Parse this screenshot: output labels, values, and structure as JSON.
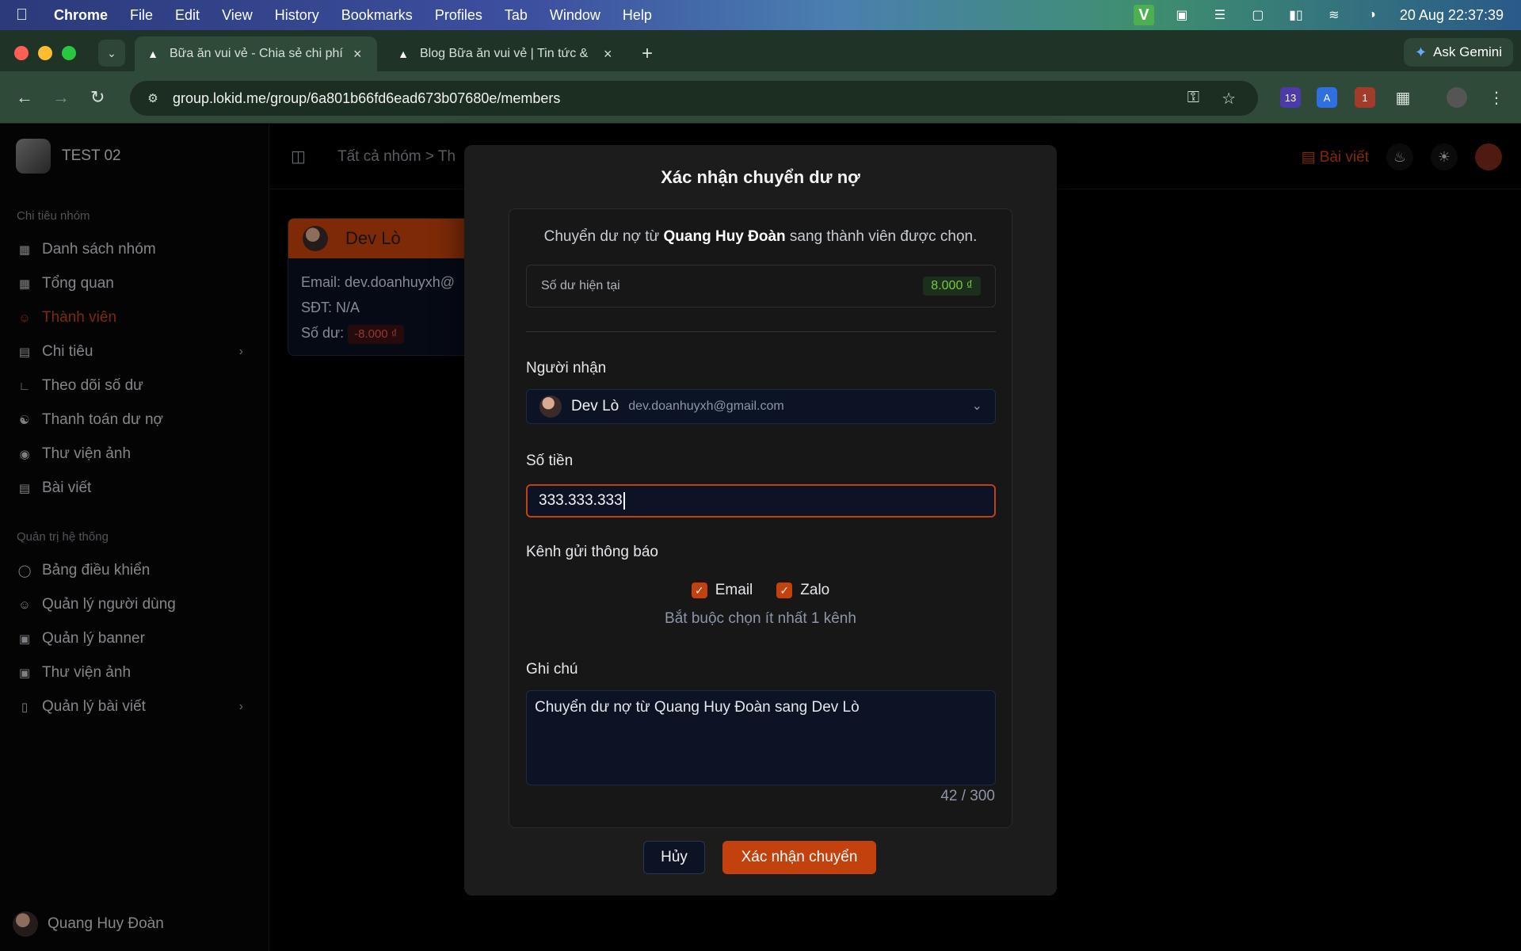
{
  "menubar": {
    "items": [
      "Chrome",
      "File",
      "Edit",
      "View",
      "History",
      "Bookmarks",
      "Profiles",
      "Tab",
      "Window",
      "Help"
    ],
    "datetime": "20 Aug  22:37:39"
  },
  "browser": {
    "tabs": [
      {
        "title": "Bữa ăn vui vẻ - Chia sẻ chi phí",
        "active": true
      },
      {
        "title": "Blog Bữa ăn vui vẻ | Tin tức &",
        "active": false
      }
    ],
    "url": "group.lokid.me/group/6a801b66fd6ead673b07680e/members",
    "gemini_label": "Ask Gemini",
    "ext_badges": [
      "13",
      "1"
    ]
  },
  "sidebar": {
    "brand": "TEST 02",
    "section1": "Chi tiêu nhóm",
    "items1": [
      "Danh sách nhóm",
      "Tổng quan",
      "Thành viên",
      "Chi tiêu",
      "Theo dõi số dư",
      "Thanh toán dư nợ",
      "Thư viện ảnh",
      "Bài viết"
    ],
    "section2": "Quản trị hệ thống",
    "items2": [
      "Bảng điều khiển",
      "Quản lý người dùng",
      "Quản lý banner",
      "Thư viện ảnh",
      "Quản lý bài viết"
    ],
    "user": "Quang Huy Đoàn"
  },
  "header": {
    "crumb": "Tất cả nhóm  >  Th",
    "posts": "Bài viết"
  },
  "member_card": {
    "name": "Dev Lò",
    "email": "Email: dev.doanhuyxh@",
    "phone": "SĐT: N/A",
    "balance_label": "Số dư:",
    "balance": "-8.000 ₫"
  },
  "modal": {
    "title": "Xác nhận chuyển dư nợ",
    "desc_pre": "Chuyển dư nợ từ ",
    "desc_from": "Quang Huy Đoàn",
    "desc_post": " sang thành viên được chọn.",
    "balance_label": "Số dư hiện tại",
    "balance_value": "8.000 ₫",
    "recipient_label": "Người nhận",
    "recipient_name": "Dev Lò",
    "recipient_email": "dev.doanhuyxh@gmail.com",
    "amount_label": "Số tiền",
    "amount_value": "333.333.333",
    "channel_label": "Kênh gửi thông báo",
    "channel_email": "Email",
    "channel_zalo": "Zalo",
    "channel_hint": "Bắt buộc chọn ít nhất 1 kênh",
    "note_label": "Ghi chú",
    "note_value": "Chuyển dư nợ từ Quang Huy Đoàn sang Dev Lò",
    "note_count": "42 / 300",
    "cancel": "Hủy",
    "confirm": "Xác nhận chuyển"
  }
}
